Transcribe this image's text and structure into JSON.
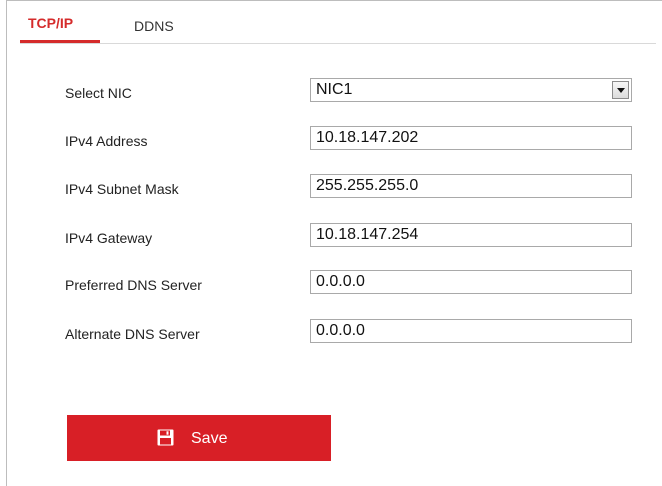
{
  "tabs": [
    {
      "label": "TCP/IP",
      "active": true
    },
    {
      "label": "DDNS",
      "active": false
    }
  ],
  "form": {
    "select_nic": {
      "label": "Select NIC",
      "value": "NIC1"
    },
    "ipv4_address": {
      "label": "IPv4 Address",
      "value": "10.18.147.202"
    },
    "ipv4_subnet_mask": {
      "label": "IPv4 Subnet Mask",
      "value": "255.255.255.0"
    },
    "ipv4_gateway": {
      "label": "IPv4 Gateway",
      "value": "10.18.147.254"
    },
    "preferred_dns": {
      "label": "Preferred DNS Server",
      "value": "0.0.0.0"
    },
    "alternate_dns": {
      "label": "Alternate DNS Server",
      "value": "0.0.0.0"
    }
  },
  "actions": {
    "save_label": "Save",
    "save_icon": "floppy-disk-icon"
  },
  "colors": {
    "accent": "#d52b2b",
    "button": "#d81f26"
  }
}
